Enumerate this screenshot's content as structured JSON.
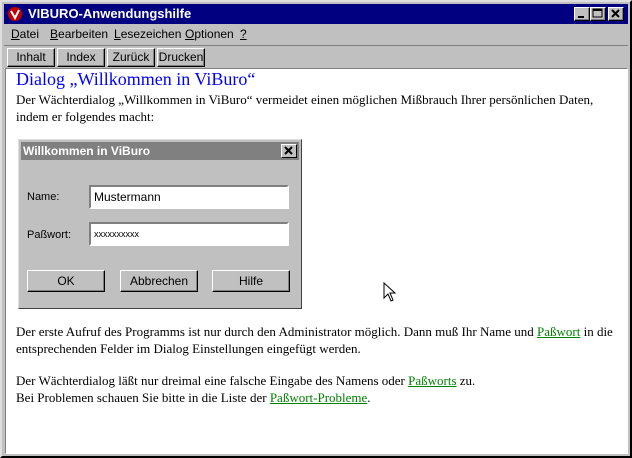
{
  "window": {
    "title": "VIBURO-Anwendungshilfe"
  },
  "menu": [
    {
      "label": "Datei",
      "u": "D",
      "rest": "atei"
    },
    {
      "label": "Bearbeiten",
      "u": "B",
      "rest": "earbeiten"
    },
    {
      "label": "Lesezeichen",
      "u": "L",
      "rest": "esezeichen"
    },
    {
      "label": "Optionen",
      "u": "O",
      "rest": "ptionen"
    },
    {
      "label": "?",
      "u": "?",
      "rest": ""
    }
  ],
  "toolbar": {
    "inhalt": "Inhalt",
    "index": "Index",
    "zurueck": "Zurück",
    "drucken": "Drucken"
  },
  "content": {
    "heading": "Dialog „Willkommen in ViBuro“",
    "intro_line1": "Der Wächterdialog „Willkommen in ViBuro“ vermeidet einen möglichen Mißbrauch Ihrer persönlichen Daten,",
    "intro_line2": "indem er folgendes macht:",
    "para2_a": "Der erste Aufruf des Programms ist nur durch den Administrator möglich. Dann muß Ihr Name und ",
    "para2_link": "Paßwort",
    "para2_b": " in die",
    "para2_line2": "entsprechenden Felder im Dialog Einstellungen eingefügt werden.",
    "para3_a": "Der Wächterdialog läßt nur dreimal eine falsche Eingabe des Namens oder  ",
    "para3_link": "Paßworts",
    "para3_b": " zu.",
    "para4_a": "Bei Problemen schauen Sie bitte in die Liste der ",
    "para4_link": "Paßwort-Probleme",
    "para4_b": "."
  },
  "dialog": {
    "title": "Willkommen in ViBuro",
    "name_label": "Name:",
    "name_value": "Mustermann",
    "password_label": "Paßwort:",
    "password_value": "xxxxxxxxxx",
    "ok": "OK",
    "cancel": "Abbrechen",
    "help": "Hilfe"
  }
}
